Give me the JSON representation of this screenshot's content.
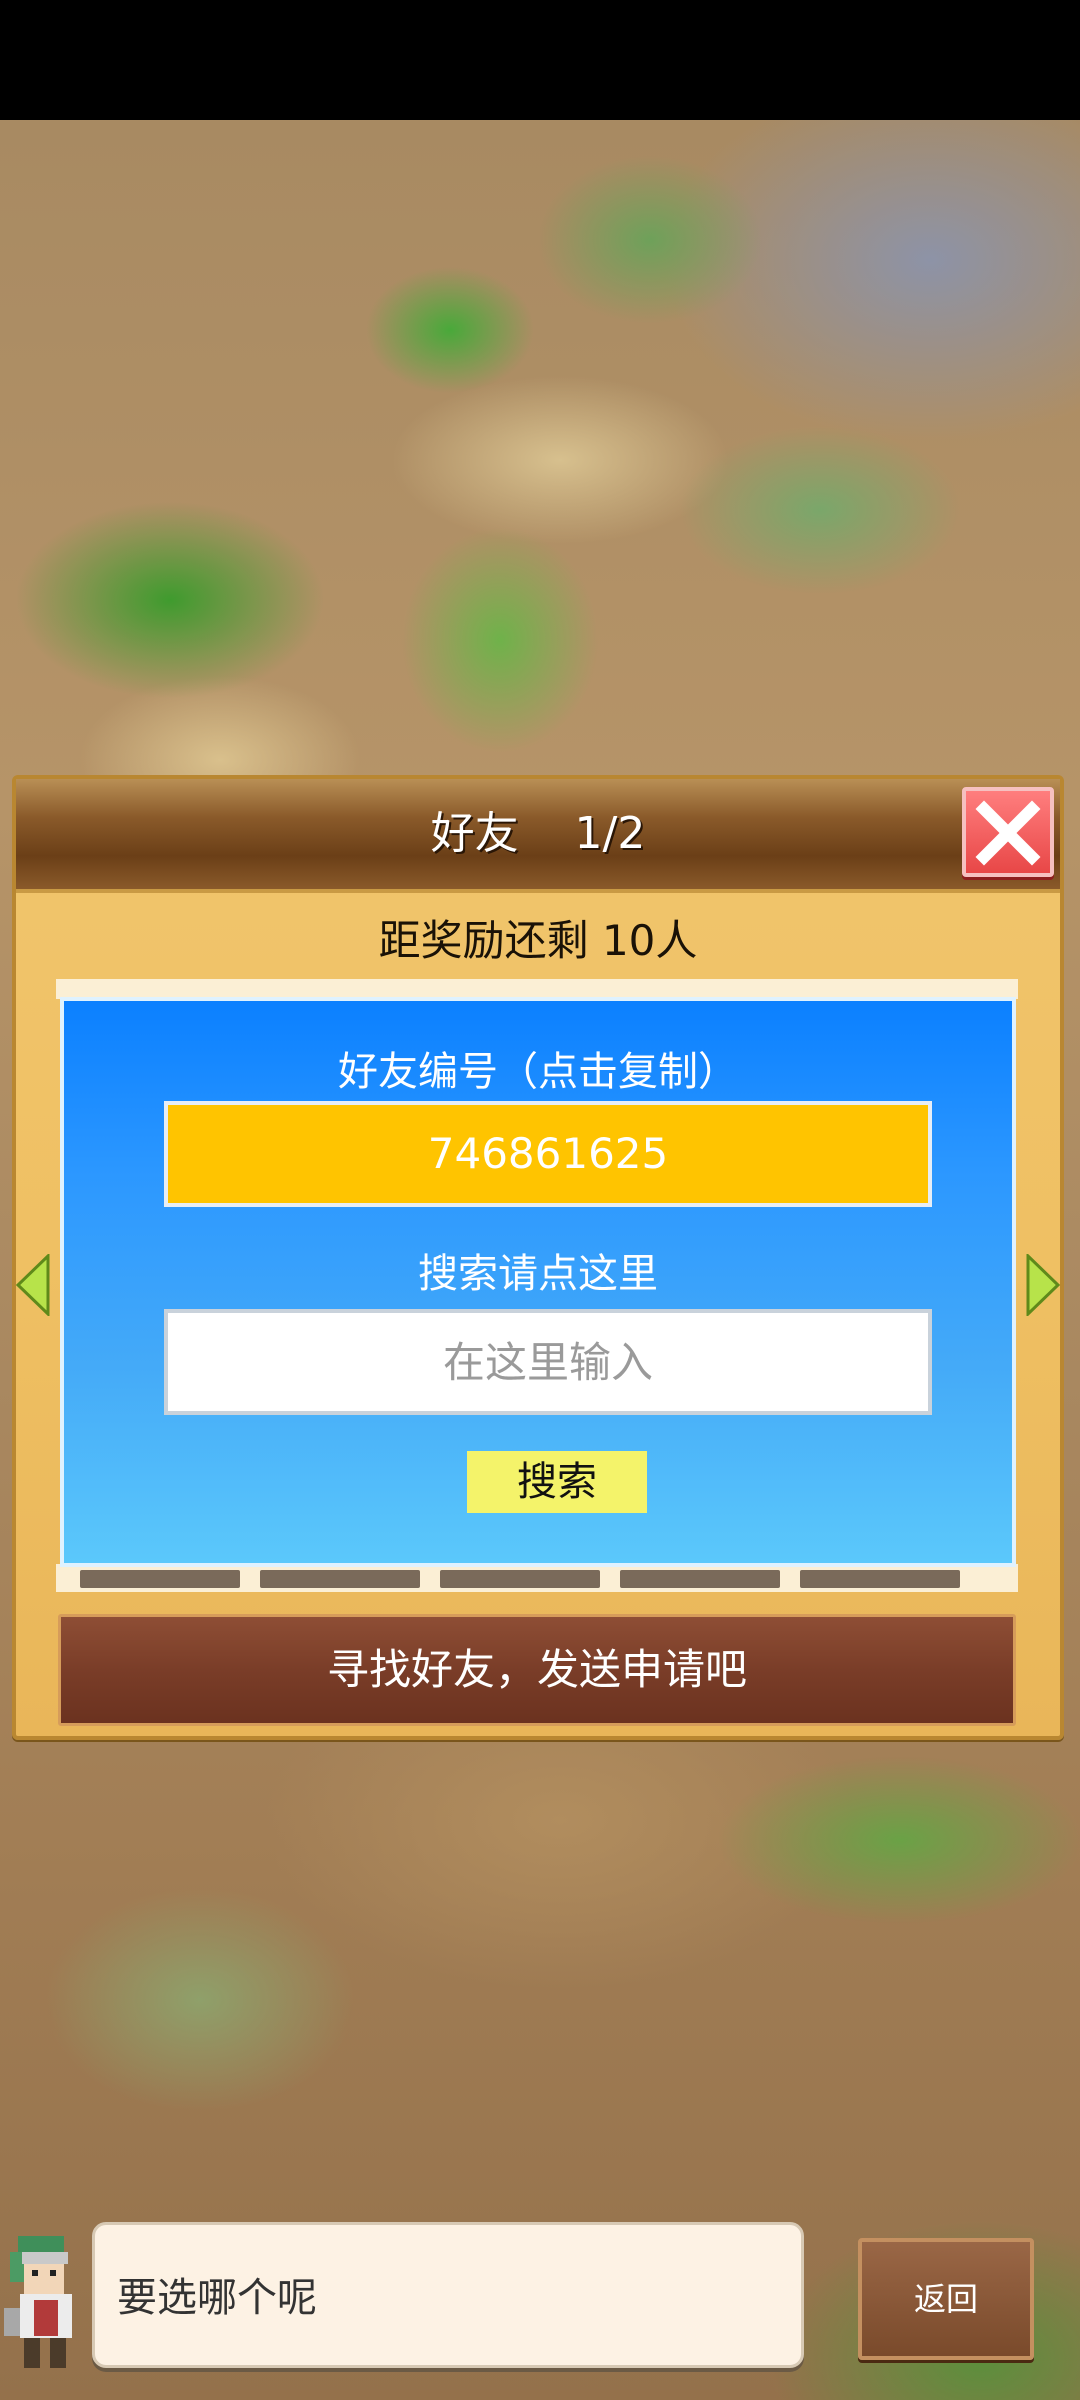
{
  "dialog": {
    "title": "好友    1/2",
    "reward_text": "距奖励还剩 10人"
  },
  "panel": {
    "id_label": "好友编号（点击复制）",
    "friend_id": "746861625",
    "search_label": "搜索请点这里",
    "search_placeholder": "在这里输入",
    "search_button": "搜索"
  },
  "send_request_button": "寻找好友，发送申请吧",
  "dialogue": {
    "text": "要选哪个呢"
  },
  "back_button": "返回",
  "colors": {
    "panel_blue_top": "#0b80ff",
    "panel_blue_bottom": "#5bc8fb",
    "id_box": "#ffc400",
    "search_button": "#f4f36a",
    "close_button": "#e84747",
    "header_brown": "#6b3f17",
    "send_button": "#7a3d28"
  },
  "icons": {
    "close": "close-icon",
    "prev": "arrow-left-icon",
    "next": "arrow-right-icon",
    "avatar": "character-avatar-icon"
  }
}
